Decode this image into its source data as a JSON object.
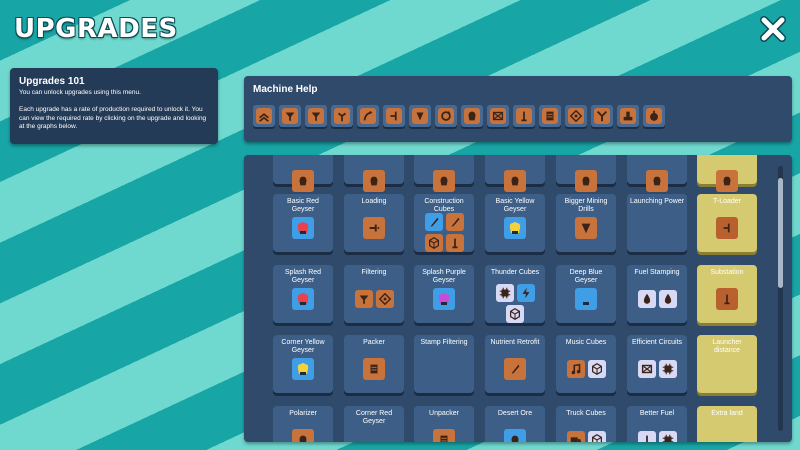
{
  "title": "UPGRADES",
  "info": {
    "heading": "Upgrades 101",
    "text": "You can unlock upgrades using this menu.\n\nEach upgrade has a rate of production required to unlock it. You can view the required rate by clicking on the upgrade and looking at the graphs below."
  },
  "machine_help": {
    "title": "Machine Help",
    "buttons": [
      "stacker-icon",
      "filter-icon",
      "filter-icon",
      "splitter-icon",
      "curve-icon",
      "merger-icon",
      "funnel-icon",
      "rotator-icon",
      "geyser-icon",
      "stamp-icon",
      "launcher-icon",
      "packer-icon",
      "diamond-icon",
      "y-splitter-icon",
      "pump-icon",
      "cooker-icon"
    ]
  },
  "upgrades": {
    "row0": [
      "",
      "",
      "",
      "",
      "",
      "",
      ""
    ],
    "row1": [
      "Basic Red Geyser",
      "Loading",
      "Construction Cubes",
      "Basic Yellow Geyser",
      "Bigger Mining Drills",
      "Launching Power",
      "T-Loader"
    ],
    "row2": [
      "Splash Red Geyser",
      "Filtering",
      "Splash Purple Geyser",
      "Thunder Cubes",
      "Deep Blue Geyser",
      "Fuel Stamping",
      "Substation"
    ],
    "row3": [
      "Corner Yellow Geyser",
      "Packer",
      "Stamp Filtering",
      "Nutrient Retrofit",
      "Music Cubes",
      "Efficient Circuits",
      "Launcher distance"
    ],
    "row4": [
      "Polarizer",
      "Corner Red Geyser",
      "Unpacker",
      "Desert Ore",
      "Truck Cubes",
      "Better Fuel",
      "Extra land"
    ]
  },
  "colors": {
    "bg_dark_stripe": "#18a5a6",
    "bg_light_stripe": "#6fd9cf",
    "panel": "#2f4a6b",
    "card": "#3d5f87",
    "card_locked_yellow": "#d6ca70",
    "icon_orange": "#c8723c",
    "icon_blue": "#3f9ee6"
  }
}
